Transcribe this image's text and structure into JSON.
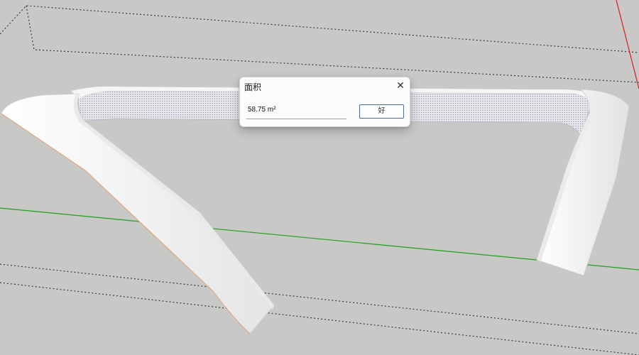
{
  "dialog": {
    "title": "面积",
    "close_icon": "close-icon",
    "value": "58.75 m²",
    "ok_label": "好"
  },
  "colors": {
    "background": "#c8c8c6",
    "axis_green": "#1fa01f",
    "axis_red": "#d02020",
    "model_face": "#f4f4f4",
    "selected_face": "#e6e6ec"
  }
}
